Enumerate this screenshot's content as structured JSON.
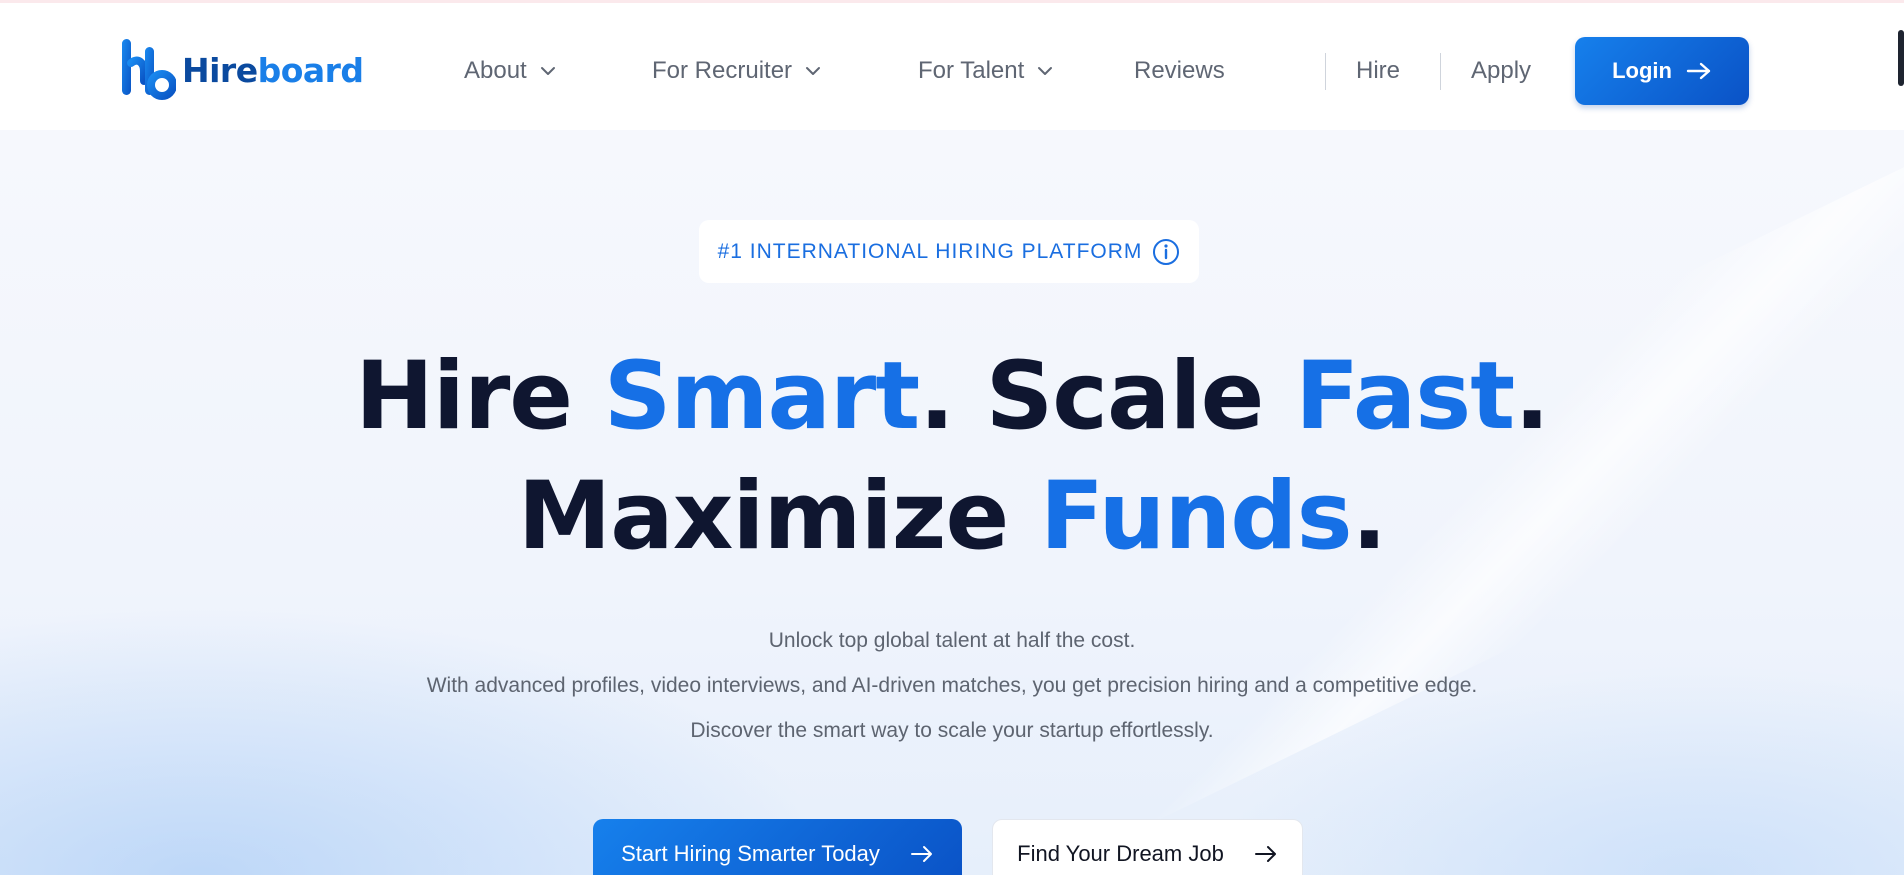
{
  "brand": {
    "name_part1": "Hire",
    "name_part2": "board",
    "logo_icon": "hb-monogram-icon",
    "colors": {
      "dark": "#0b4a9f",
      "light": "#1a7fe8"
    }
  },
  "nav": {
    "items": [
      {
        "label": "About",
        "has_dropdown": true
      },
      {
        "label": "For Recruiter",
        "has_dropdown": true
      },
      {
        "label": "For Talent",
        "has_dropdown": true
      },
      {
        "label": "Reviews",
        "has_dropdown": false
      }
    ],
    "links": [
      {
        "label": "Hire"
      },
      {
        "label": "Apply"
      }
    ],
    "login_label": "Login"
  },
  "hero": {
    "badge": "#1 INTERNATIONAL HIRING PLATFORM",
    "headline_line1": {
      "w1": "Hire ",
      "w2": "Smart",
      "w3": ". Scale ",
      "w4": "Fast",
      "w5": "."
    },
    "headline_line2": {
      "w1": "Maximize ",
      "w2": "Funds",
      "w3": "."
    },
    "subtext": [
      "Unlock top global talent at half the cost.",
      "With advanced profiles, video interviews, and AI-driven matches, you get precision hiring and a competitive edge.",
      "Discover the smart way to scale your startup effortlessly."
    ],
    "cta_primary": "Start Hiring Smarter Today",
    "cta_secondary": "Find Your Dream Job"
  },
  "theme": {
    "accent": "#1670e6",
    "heading": "#0f1630",
    "muted": "#5d6470"
  }
}
